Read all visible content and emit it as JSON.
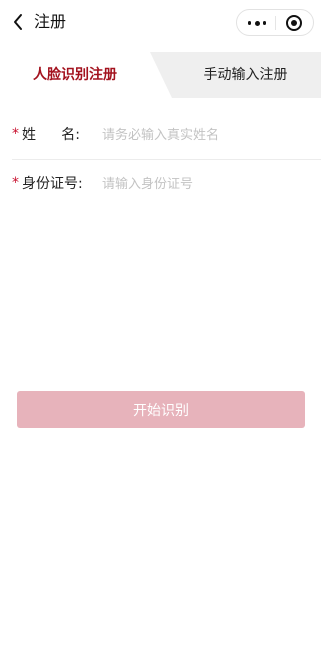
{
  "navbar": {
    "title": "注册",
    "back_icon": "chevron-left-icon",
    "more_icon": "more-dots-icon",
    "record_icon": "target-circle-icon"
  },
  "tabs": [
    {
      "label": "人脸识别注册",
      "active": true
    },
    {
      "label": "手动输入注册",
      "active": false
    }
  ],
  "form": {
    "required_mark": "*",
    "name": {
      "label_chars": [
        "姓",
        "名:"
      ],
      "placeholder": "请务必输入真实姓名",
      "value": ""
    },
    "id_number": {
      "label": "身份证号:",
      "placeholder": "请输入身份证号",
      "value": ""
    }
  },
  "actions": {
    "start_label": "开始识别"
  },
  "colors": {
    "accent": "#a3121e",
    "required": "#c8102e",
    "button_disabled": "#e7b3bb",
    "tab_inactive_bg": "#efefef",
    "placeholder": "#c3c3c3"
  }
}
